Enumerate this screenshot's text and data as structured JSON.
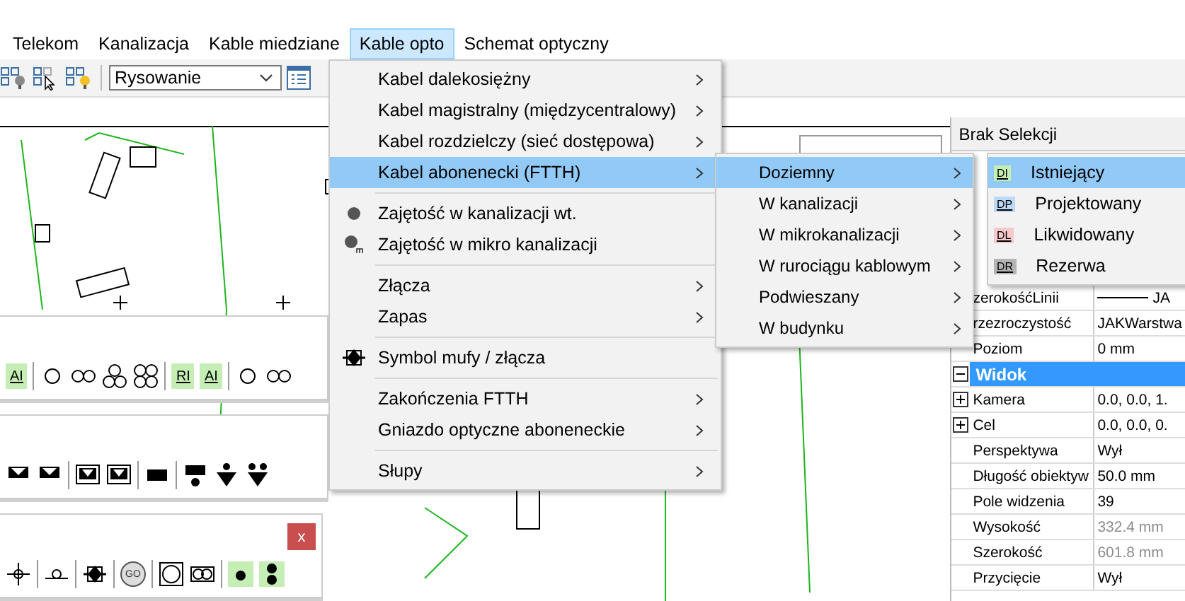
{
  "menubar": [
    {
      "label": "Telekom",
      "selected": false
    },
    {
      "label": "Kanalizacja",
      "selected": false
    },
    {
      "label": "Kable miedziane",
      "selected": false
    },
    {
      "label": "Kable opto",
      "selected": true
    },
    {
      "label": "Schemat optyczny",
      "selected": false
    }
  ],
  "toolbar": {
    "mode_select": {
      "value": "Rysowanie"
    }
  },
  "menu": {
    "items": [
      {
        "kind": "item",
        "label": "Kabel dalekosiężny",
        "submenu": true,
        "selected": false
      },
      {
        "kind": "item",
        "label": "Kabel magistralny (międzycentralowy)",
        "submenu": true,
        "selected": false
      },
      {
        "kind": "item",
        "label": "Kabel rozdzielczy (sieć dostępowa)",
        "submenu": true,
        "selected": false
      },
      {
        "kind": "item",
        "label": "Kabel abonenecki (FTTH)",
        "submenu": true,
        "selected": true
      },
      {
        "kind": "separator"
      },
      {
        "kind": "dot-item",
        "label": "Zajętość w kanalizacji wt.",
        "submenu": false,
        "selected": false
      },
      {
        "kind": "dot-m-item",
        "label": "Zajętość w mikro kanalizacji",
        "submenu": false,
        "selected": false
      },
      {
        "kind": "separator"
      },
      {
        "kind": "item",
        "label": "Złącza",
        "submenu": true,
        "selected": false
      },
      {
        "kind": "item",
        "label": "Zapas",
        "submenu": true,
        "selected": false
      },
      {
        "kind": "separator"
      },
      {
        "kind": "splice-item",
        "label": "Symbol mufy / złącza",
        "submenu": false,
        "selected": false
      },
      {
        "kind": "separator"
      },
      {
        "kind": "item",
        "label": "Zakończenia FTTH",
        "submenu": true,
        "selected": false
      },
      {
        "kind": "item",
        "label": "Gniazdo optyczne aboneneckie",
        "submenu": true,
        "selected": false
      },
      {
        "kind": "separator"
      },
      {
        "kind": "item",
        "label": "Słupy",
        "submenu": true,
        "selected": false
      }
    ]
  },
  "submenu": {
    "items": [
      {
        "label": "Doziemny",
        "selected": true
      },
      {
        "label": "W kanalizacji",
        "selected": false
      },
      {
        "label": "W mikrokanalizacji",
        "selected": false
      },
      {
        "label": "W rurociągu kablowym",
        "selected": false
      },
      {
        "label": "Podwieszany",
        "selected": false
      },
      {
        "label": "W budynku",
        "selected": false
      }
    ]
  },
  "submenu2": {
    "items": [
      {
        "badge": "DI",
        "color": "#c4eeb4",
        "label": "Istniejący",
        "selected": true
      },
      {
        "badge": "DP",
        "color": "#bcd9f7",
        "label": "Projektowany",
        "selected": false
      },
      {
        "badge": "DL",
        "color": "#f7c9cc",
        "label": "Likwidowany",
        "selected": false
      },
      {
        "badge": "DR",
        "color": "#b4b4b4",
        "label": "Rezerwa",
        "selected": false
      }
    ]
  },
  "properties": {
    "header": "Brak Selekcji",
    "rows": [
      {
        "kind": "prop",
        "name": "zerokośćLinii",
        "value": "JA",
        "line": true
      },
      {
        "kind": "prop",
        "name": "rzezroczystość",
        "value": "JAKWarstwa"
      },
      {
        "kind": "prop",
        "name": "Poziom",
        "value": "0 mm"
      },
      {
        "kind": "section",
        "name": "Widok",
        "expanded": true
      },
      {
        "kind": "prop",
        "name": "Kamera",
        "value": "0.0, 0.0, 1.",
        "expandable": true
      },
      {
        "kind": "prop",
        "name": "Cel",
        "value": "0.0, 0.0, 0.",
        "expandable": true
      },
      {
        "kind": "prop",
        "name": "Perspektywa",
        "value": "Wył"
      },
      {
        "kind": "prop",
        "name": "Długość obiektyw",
        "value": "50.0 mm"
      },
      {
        "kind": "prop",
        "name": "Pole widzenia",
        "value": "39"
      },
      {
        "kind": "prop",
        "name": "Wysokość",
        "value": "332.4 mm",
        "disabled": true
      },
      {
        "kind": "prop",
        "name": "Szerokość",
        "value": "601.8 mm",
        "disabled": true
      },
      {
        "kind": "prop",
        "name": "Przycięcie",
        "value": "Wył"
      }
    ]
  },
  "floating_toolbars": [
    {
      "buttons": [
        {
          "kind": "tile",
          "label": "AI"
        },
        {
          "kind": "sep"
        },
        {
          "kind": "ring1"
        },
        {
          "kind": "ring2"
        },
        {
          "kind": "ring3"
        },
        {
          "kind": "ring4"
        },
        {
          "kind": "sep"
        },
        {
          "kind": "tile",
          "label": "RI"
        },
        {
          "kind": "tile",
          "label": "AI"
        },
        {
          "kind": "sep"
        },
        {
          "kind": "ring1"
        },
        {
          "kind": "ring2"
        }
      ]
    },
    {
      "buttons": [
        {
          "kind": "tri"
        },
        {
          "kind": "tri"
        },
        {
          "kind": "sep"
        },
        {
          "kind": "framed"
        },
        {
          "kind": "framed"
        },
        {
          "kind": "sep"
        },
        {
          "kind": "block"
        },
        {
          "kind": "sep"
        },
        {
          "kind": "block-dot"
        },
        {
          "kind": "dot-tri"
        },
        {
          "kind": "dots-tri"
        }
      ]
    },
    {
      "close": "x",
      "buttons": [
        {
          "kind": "cross"
        },
        {
          "kind": "sep"
        },
        {
          "kind": "line-ring"
        },
        {
          "kind": "sep"
        },
        {
          "kind": "splice"
        },
        {
          "kind": "sep"
        },
        {
          "kind": "tile-ring",
          "label": "GO"
        },
        {
          "kind": "sep"
        },
        {
          "kind": "square-ring"
        },
        {
          "kind": "double-ring"
        },
        {
          "kind": "sep"
        },
        {
          "kind": "dot-tile"
        },
        {
          "kind": "dots-tile"
        }
      ]
    }
  ]
}
